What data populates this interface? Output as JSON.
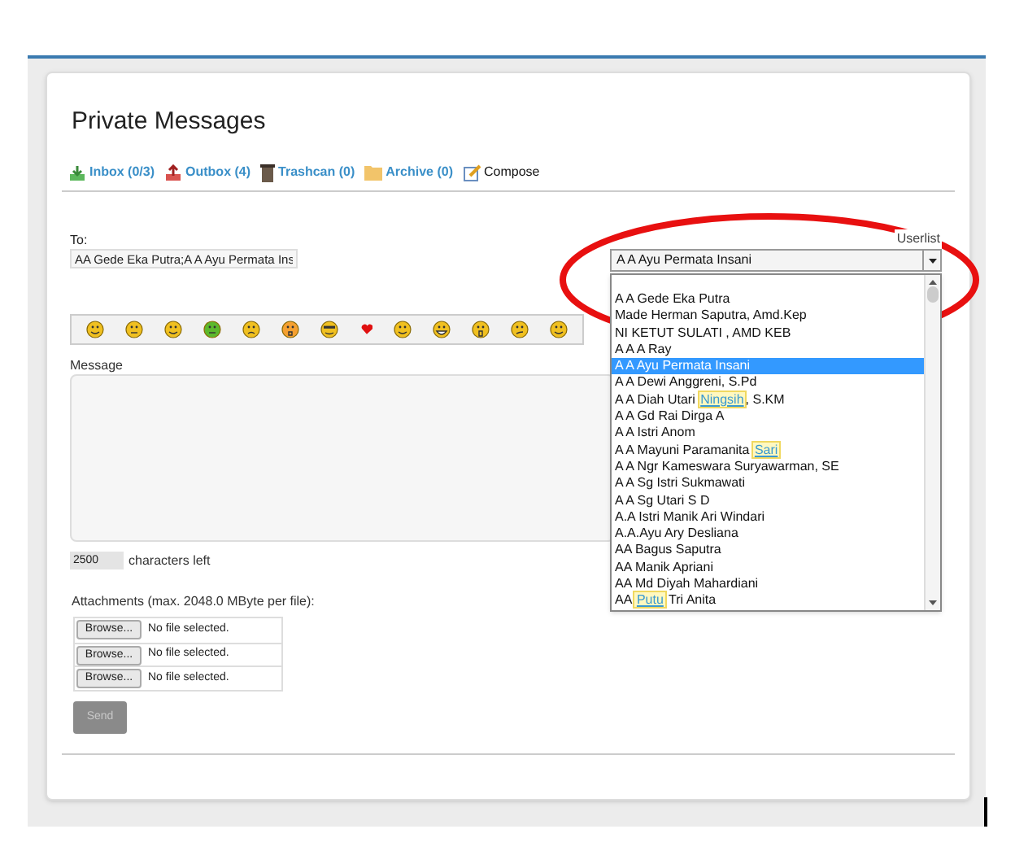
{
  "page_title": "Private Messages",
  "tabs": [
    {
      "label": "Inbox (0/3)",
      "kind": "inbox",
      "selected": false
    },
    {
      "label": "Outbox (4)",
      "kind": "outbox",
      "selected": false
    },
    {
      "label": "Trashcan (0)",
      "kind": "trash",
      "selected": false
    },
    {
      "label": "Archive (0)",
      "kind": "archive",
      "selected": false
    },
    {
      "label": "Compose",
      "kind": "compose",
      "selected": true
    }
  ],
  "to": {
    "label": "To:",
    "value": "AA Gede Eka Putra;A A Ayu Permata Ins"
  },
  "userlist": {
    "label": "Userlist",
    "value": "A A Ayu Permata Insani",
    "options": [
      {
        "segments": [
          {
            "text": "A A Gede Eka Putra"
          }
        ],
        "selected": false
      },
      {
        "segments": [
          {
            "text": "Made Herman Saputra, Amd.Kep"
          }
        ],
        "selected": false
      },
      {
        "segments": [
          {
            "text": "NI KETUT SULATI , AMD KEB"
          }
        ],
        "selected": false
      },
      {
        "segments": [
          {
            "text": "A A A Ray"
          }
        ],
        "selected": false
      },
      {
        "segments": [
          {
            "text": "A A Ayu Permata Insani"
          }
        ],
        "selected": true
      },
      {
        "segments": [
          {
            "text": "A A Dewi Anggreni, S.Pd"
          }
        ],
        "selected": false
      },
      {
        "segments": [
          {
            "text": "A A Diah Utari "
          },
          {
            "text": "Ningsih",
            "highlighted": true
          },
          {
            "text": ", S.KM"
          }
        ],
        "selected": false
      },
      {
        "segments": [
          {
            "text": "A A Gd Rai Dirga A"
          }
        ],
        "selected": false
      },
      {
        "segments": [
          {
            "text": "A A Istri Anom"
          }
        ],
        "selected": false
      },
      {
        "segments": [
          {
            "text": "A A Mayuni Paramanita "
          },
          {
            "text": "Sari",
            "highlighted": true
          }
        ],
        "selected": false
      },
      {
        "segments": [
          {
            "text": "A A Ngr Kameswara Suryawarman, SE"
          }
        ],
        "selected": false
      },
      {
        "segments": [
          {
            "text": "A A Sg Istri Sukmawati"
          }
        ],
        "selected": false
      },
      {
        "segments": [
          {
            "text": "A A Sg Utari S D"
          }
        ],
        "selected": false
      },
      {
        "segments": [
          {
            "text": "A.A Istri Manik Ari Windari"
          }
        ],
        "selected": false
      },
      {
        "segments": [
          {
            "text": "A.A.Ayu Ary Desliana"
          }
        ],
        "selected": false
      },
      {
        "segments": [
          {
            "text": "AA Bagus Saputra"
          }
        ],
        "selected": false
      },
      {
        "segments": [
          {
            "text": "AA Manik Apriani"
          }
        ],
        "selected": false
      },
      {
        "segments": [
          {
            "text": "AA Md Diyah Mahardiani"
          }
        ],
        "selected": false
      },
      {
        "segments": [
          {
            "text": "AA "
          },
          {
            "text": "Putu",
            "highlighted": true
          },
          {
            "text": " Tri Anita"
          }
        ],
        "selected": false
      }
    ]
  },
  "emoticons": [
    {
      "kind": "smile"
    },
    {
      "kind": "neutral"
    },
    {
      "kind": "tongue"
    },
    {
      "kind": "sick"
    },
    {
      "kind": "angry"
    },
    {
      "kind": "surprised"
    },
    {
      "kind": "cool"
    },
    {
      "kind": "heart"
    },
    {
      "kind": "wink"
    },
    {
      "kind": "grin"
    },
    {
      "kind": "shocked"
    },
    {
      "kind": "confused"
    },
    {
      "kind": "smile"
    }
  ],
  "message": {
    "label": "Message"
  },
  "counter": {
    "value": "2500",
    "label": "characters left"
  },
  "attachments": {
    "label": "Attachments (max. 2048.0 MByte per file):",
    "rows": [
      {
        "button": "Browse...",
        "status": "No file selected."
      },
      {
        "button": "Browse...",
        "status": "No file selected."
      },
      {
        "button": "Browse...",
        "status": "No file selected."
      }
    ]
  },
  "send": {
    "label": "Send",
    "disabled": true
  }
}
